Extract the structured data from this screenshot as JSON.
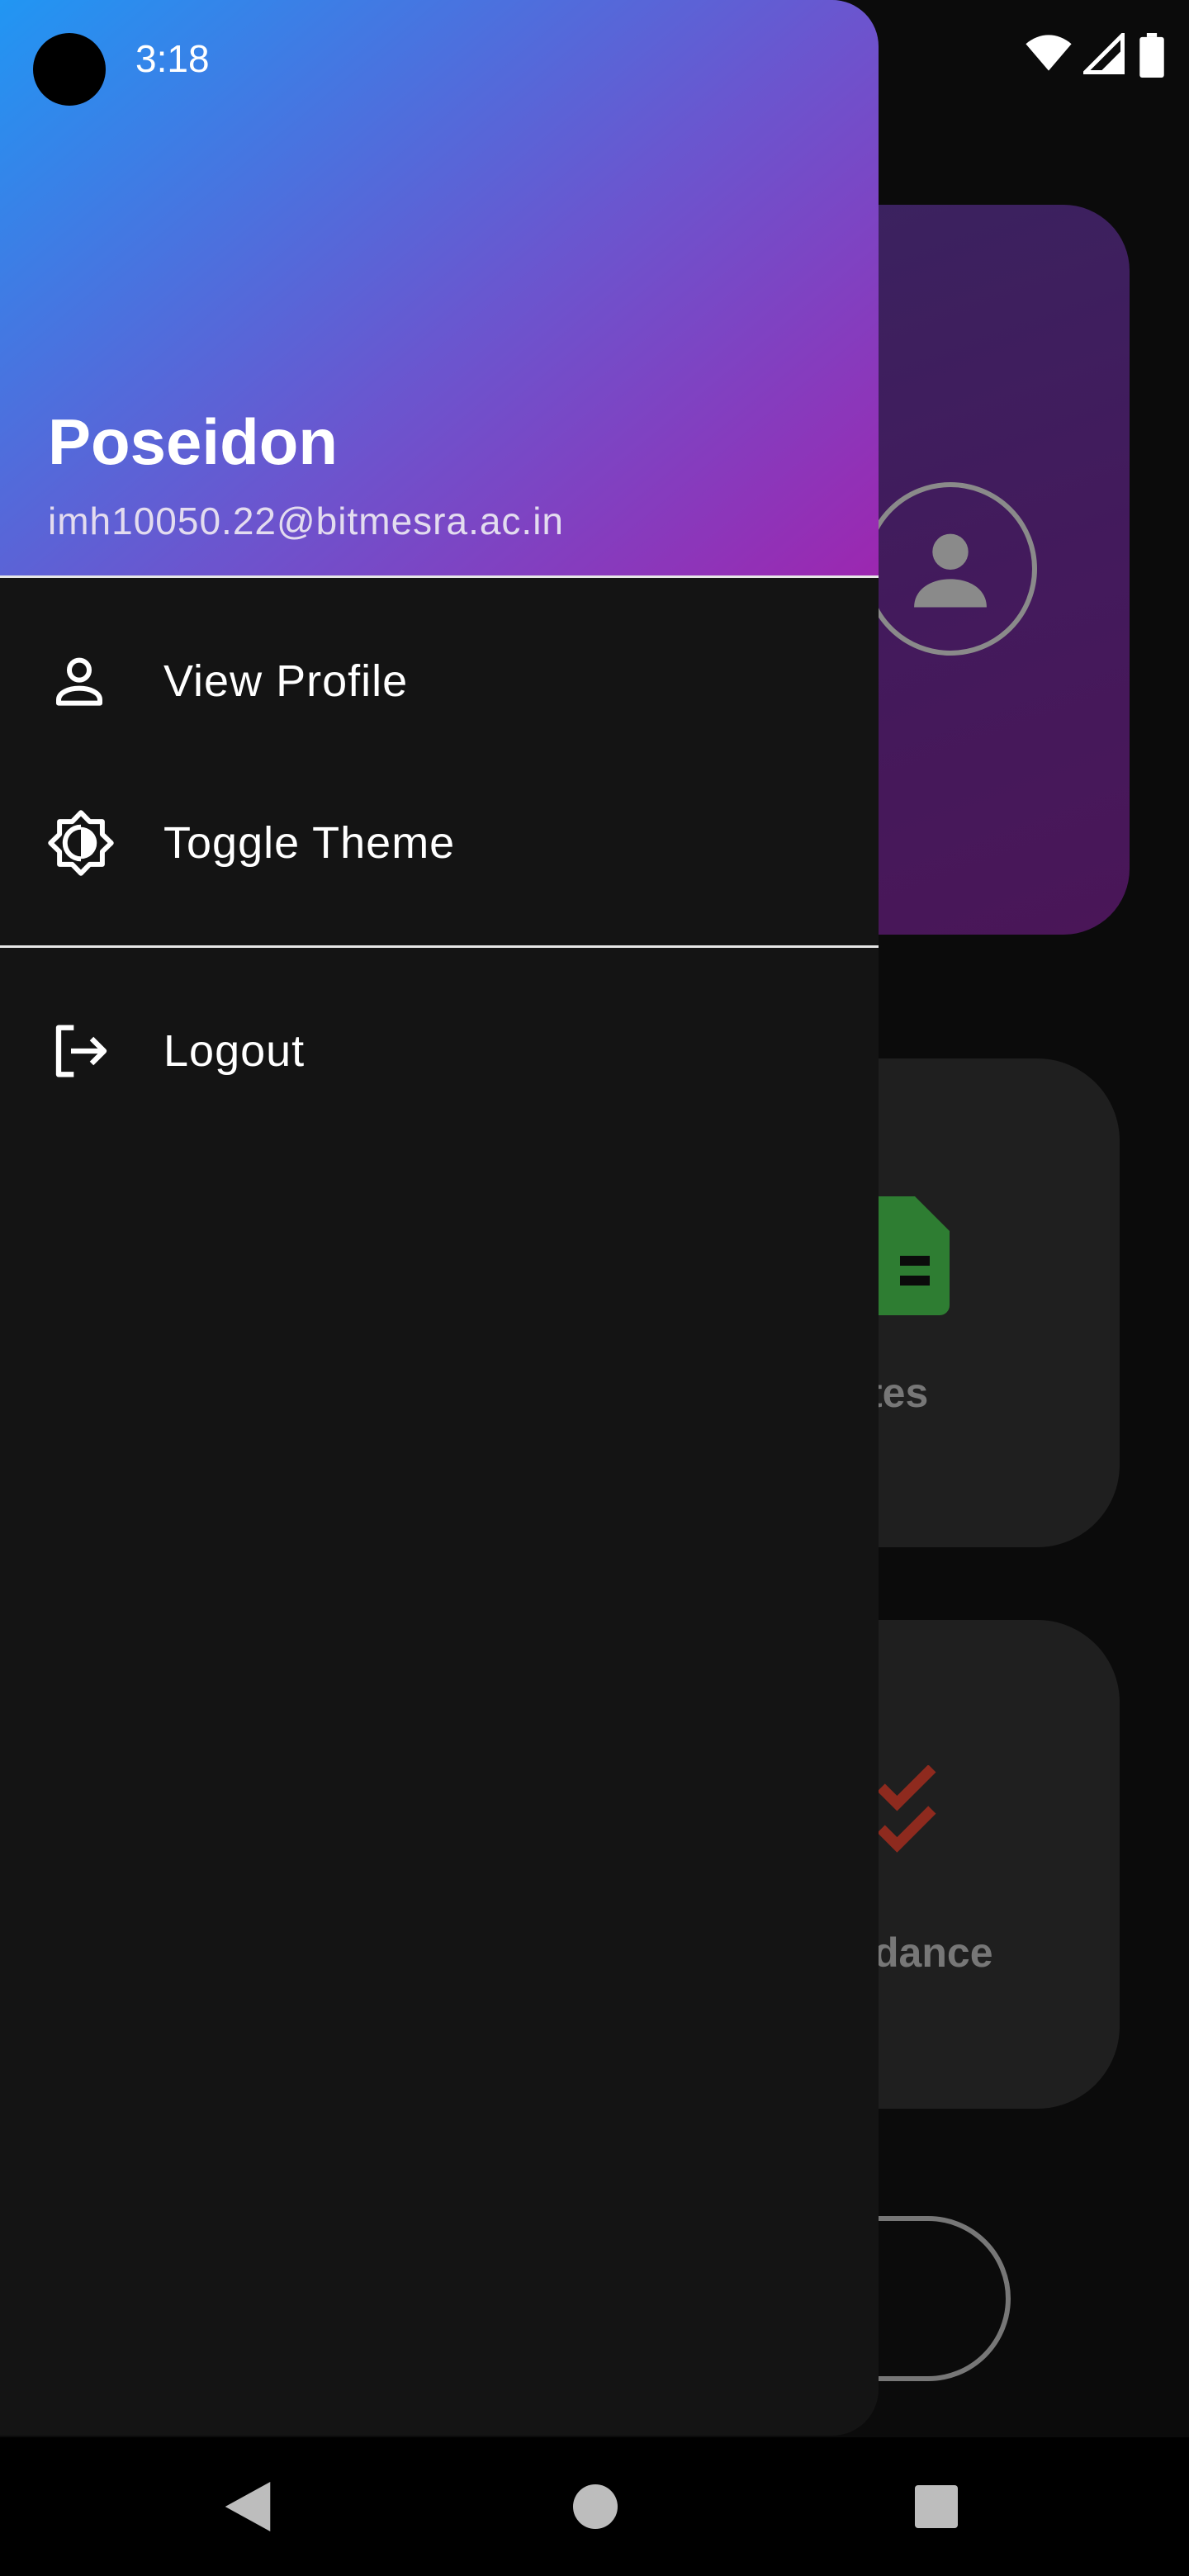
{
  "status_bar": {
    "time": "3:18",
    "icons": [
      "wifi-icon",
      "cellular-signal-icon",
      "battery-icon"
    ]
  },
  "drawer": {
    "header": {
      "name": "Poseidon",
      "email": "imh10050.22@bitmesra.ac.in",
      "gradient": [
        "#2196F3",
        "#9C27B0"
      ]
    },
    "items": [
      {
        "label": "View Profile",
        "icon": "person-icon"
      },
      {
        "label": "Toggle Theme",
        "icon": "brightness-icon"
      }
    ],
    "logout": {
      "label": "Logout",
      "icon": "logout-icon"
    }
  },
  "background": {
    "cards": [
      {
        "label_visible": "tes",
        "icon": "document-icon",
        "icon_color": "#2E7D32"
      },
      {
        "label_visible": "dance",
        "icon": "double-check-icon",
        "icon_color": "#8E2A1E"
      }
    ]
  },
  "nav_bar": {
    "buttons": [
      "back-icon",
      "home-icon",
      "recents-icon"
    ]
  }
}
